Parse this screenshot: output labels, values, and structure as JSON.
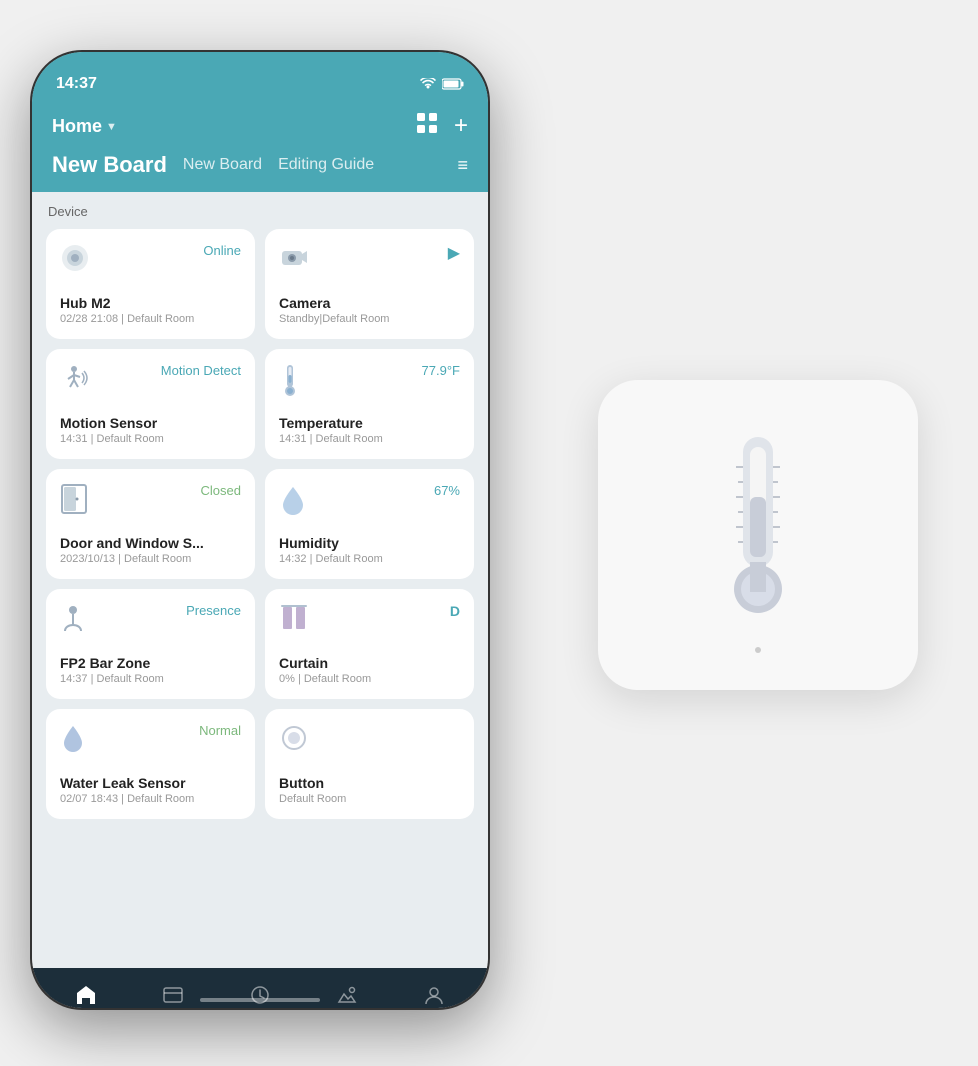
{
  "statusBar": {
    "time": "14:37",
    "wifiIcon": "wifi",
    "batteryIcon": "battery"
  },
  "header": {
    "homeLabel": "Home",
    "chevron": "▼",
    "gridIcon": "⊞",
    "addIcon": "+"
  },
  "boardTabs": {
    "activeTab": "New Board",
    "tab2": "New Board",
    "tab3": "Editing Guide",
    "menuIcon": "≡"
  },
  "deviceSection": {
    "label": "Device"
  },
  "devices": [
    {
      "id": "hub",
      "name": "Hub M2",
      "subtitle": "02/28 21:08 | Default Room",
      "status": "Online",
      "statusClass": "status-online",
      "iconType": "hub"
    },
    {
      "id": "camera",
      "name": "Camera",
      "subtitle": "Standby|Default Room",
      "status": "▶",
      "statusClass": "play-icon",
      "iconType": "camera"
    },
    {
      "id": "motion",
      "name": "Motion Sensor",
      "subtitle": "14:31 | Default Room",
      "status": "Motion Detect",
      "statusClass": "status-motion",
      "iconType": "motion"
    },
    {
      "id": "temperature",
      "name": "Temperature",
      "subtitle": "14:31 | Default Room",
      "status": "77.9°F",
      "statusClass": "status-temp",
      "iconType": "temperature"
    },
    {
      "id": "door",
      "name": "Door and Window S...",
      "subtitle": "2023/10/13 | Default Room",
      "status": "Closed",
      "statusClass": "status-closed",
      "iconType": "door"
    },
    {
      "id": "humidity",
      "name": "Humidity",
      "subtitle": "14:32 | Default Room",
      "status": "67%",
      "statusClass": "status-humidity",
      "iconType": "humidity"
    },
    {
      "id": "fp2",
      "name": "FP2 Bar Zone",
      "subtitle": "14:37 | Default Room",
      "status": "Presence",
      "statusClass": "status-presence",
      "iconType": "presence"
    },
    {
      "id": "curtain",
      "name": "Curtain",
      "subtitle": "0% | Default Room",
      "status": "D",
      "statusClass": "status-online",
      "iconType": "curtain"
    },
    {
      "id": "water",
      "name": "Water Leak Sensor",
      "subtitle": "02/07 18:43 | Default Room",
      "status": "Normal",
      "statusClass": "status-normal",
      "iconType": "water"
    },
    {
      "id": "button",
      "name": "Button",
      "subtitle": "Default Room",
      "status": "",
      "statusClass": "",
      "iconType": "button"
    }
  ],
  "bottomNav": {
    "items": [
      {
        "id": "home",
        "label": "Home",
        "active": true
      },
      {
        "id": "accessories",
        "label": "Accessories",
        "active": false
      },
      {
        "id": "automation",
        "label": "Automation",
        "active": false
      },
      {
        "id": "scene",
        "label": "Scene",
        "active": false
      },
      {
        "id": "profile",
        "label": "Profile",
        "active": false
      }
    ]
  },
  "sensorDevice": {
    "altText": "Temperature/Humidity Sensor"
  }
}
